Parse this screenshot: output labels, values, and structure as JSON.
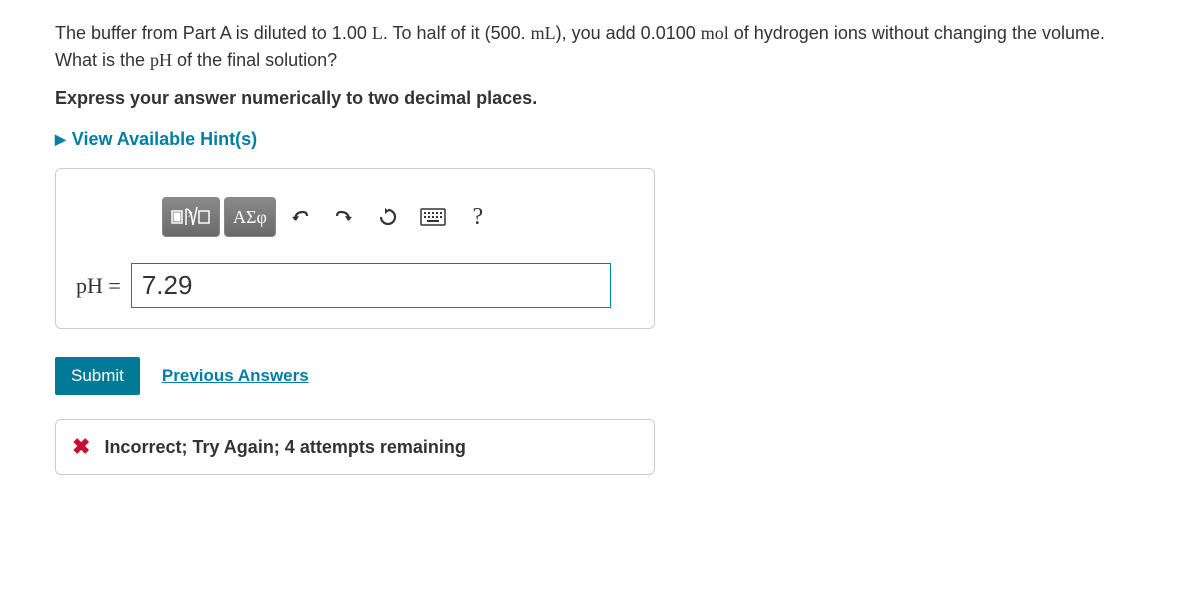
{
  "question": {
    "text_parts": [
      "The buffer from Part A is diluted to 1.00 ",
      "L",
      ". To half of it (500. ",
      "mL",
      "), you add 0.0100 ",
      "mol",
      " of hydrogen ions without changing the volume. What is the ",
      "pH",
      " of the final solution?"
    ],
    "instruction": "Express your answer numerically to two decimal places."
  },
  "hints": {
    "label": "View Available Hint(s)"
  },
  "toolbar": {
    "templates": "templates-btn",
    "greek": "ΑΣφ",
    "undo": "undo",
    "redo": "redo",
    "reset": "reset",
    "keyboard": "keyboard",
    "help": "?"
  },
  "answer": {
    "label": "pH",
    "equals": " = ",
    "value": "7.29"
  },
  "actions": {
    "submit": "Submit",
    "previous": "Previous Answers"
  },
  "feedback": {
    "text": "Incorrect; Try Again; 4 attempts remaining"
  }
}
